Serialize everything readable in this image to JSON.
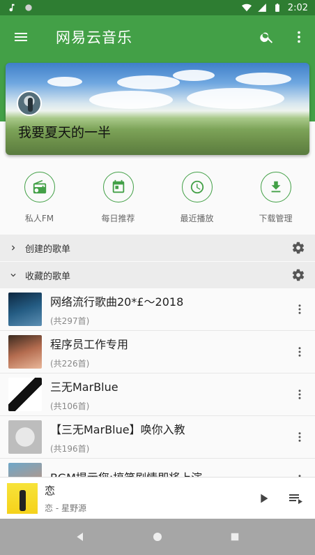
{
  "status_bar": {
    "time": "2:02"
  },
  "app_bar": {
    "title": "网易云音乐"
  },
  "banner": {
    "user_name": "我要夏天的一半"
  },
  "quick_actions": [
    {
      "label": "私人FM",
      "icon": "radio-icon"
    },
    {
      "label": "每日推荐",
      "icon": "calendar-icon"
    },
    {
      "label": "最近播放",
      "icon": "clock-icon"
    },
    {
      "label": "下载管理",
      "icon": "download-icon"
    }
  ],
  "sections": {
    "created": {
      "title": "创建的歌单"
    },
    "collected": {
      "title": "收藏的歌单"
    }
  },
  "playlists": [
    {
      "name": "网络流行歌曲20*£～2018",
      "count": "(共297首)"
    },
    {
      "name": "程序员工作专用",
      "count": "(共226首)"
    },
    {
      "name": "三无MarBlue",
      "count": "(共106首)"
    },
    {
      "name": "【三无MarBlue】唤你入教",
      "count": "(共196首)"
    },
    {
      "name": "BGM提示您:搞笑剧情即将上演",
      "count": ""
    }
  ],
  "player": {
    "song": "恋",
    "artist": "恋 - 星野源"
  },
  "colors": {
    "primary": "#43a047",
    "primary_dark": "#2e7d32"
  }
}
